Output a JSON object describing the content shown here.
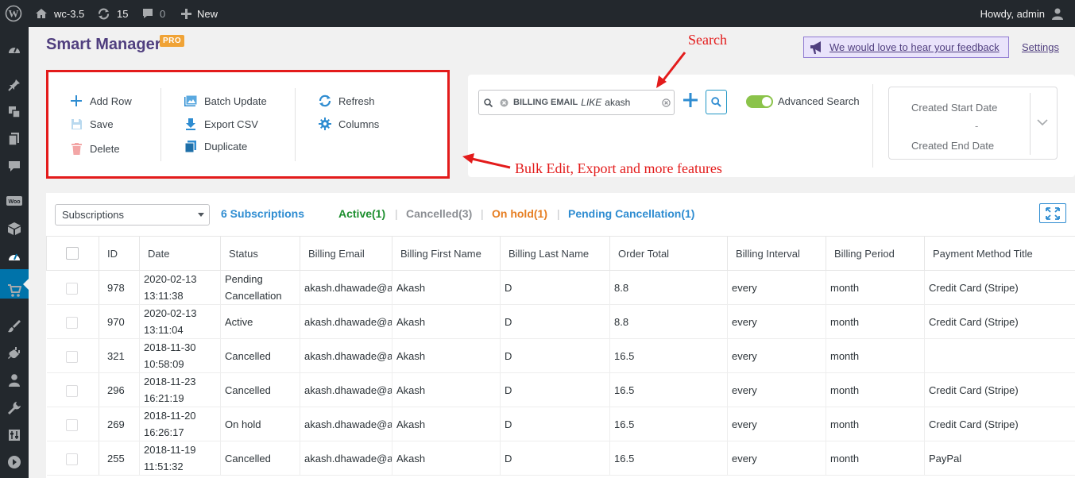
{
  "adminbar": {
    "site_name": "wc-3.5",
    "updates_count": "15",
    "comments_count": "0",
    "new_label": "New",
    "howdy": "Howdy, admin"
  },
  "header": {
    "title": "Smart Manager",
    "badge": "PRO",
    "feedback_link": "We would love to hear your feedback",
    "settings_link": "Settings"
  },
  "toolbar": {
    "add_row": "Add Row",
    "save": "Save",
    "delete": "Delete",
    "batch_update": "Batch Update",
    "export_csv": "Export CSV",
    "duplicate": "Duplicate",
    "refresh": "Refresh",
    "columns": "Columns"
  },
  "search": {
    "field": "BILLING EMAIL",
    "operator": "LIKE",
    "value": "akash",
    "advanced_label": "Advanced Search",
    "advanced_enabled": true
  },
  "date_filter": {
    "start_placeholder": "Created Start Date",
    "separator": "-",
    "end_placeholder": "Created End Date"
  },
  "annotations": {
    "search": "Search",
    "bulk": "Bulk Edit, Export and more features"
  },
  "grid": {
    "dashboard_select": "Subscriptions",
    "count_label": "6 Subscriptions",
    "filters": [
      {
        "label": "Active(1)",
        "color": "#1d8f2f"
      },
      {
        "label": "Cancelled(3)",
        "color": "#8c8f94"
      },
      {
        "label": "On hold(1)",
        "color": "#e67e22"
      },
      {
        "label": "Pending Cancellation(1)",
        "color": "#2e8cd1"
      }
    ],
    "columns": [
      "ID",
      "Date",
      "Status",
      "Billing Email",
      "Billing First Name",
      "Billing Last Name",
      "Order Total",
      "Billing Interval",
      "Billing Period",
      "Payment Method Title"
    ],
    "rows": [
      {
        "id": "978",
        "date": "2020-02-13",
        "time": "13:11:38",
        "status": "Pending Cancellation",
        "status_class": "st-pending",
        "email": "akash.dhawade@a",
        "first": "Akash",
        "last": "D",
        "total": "8.8",
        "interval": "every",
        "period": "month",
        "payment": "Credit Card (Stripe)"
      },
      {
        "id": "970",
        "date": "2020-02-13",
        "time": "13:11:04",
        "status": "Active",
        "status_class": "st-active",
        "email": "akash.dhawade@a",
        "first": "Akash",
        "last": "D",
        "total": "8.8",
        "interval": "every",
        "period": "month",
        "payment": "Credit Card (Stripe)"
      },
      {
        "id": "321",
        "date": "2018-11-30",
        "time": "10:58:09",
        "status": "Cancelled",
        "status_class": "st-cancelled",
        "email": "akash.dhawade@a",
        "first": "Akash",
        "last": "D",
        "total": "16.5",
        "interval": "every",
        "period": "month",
        "payment": ""
      },
      {
        "id": "296",
        "date": "2018-11-23",
        "time": "16:21:19",
        "status": "Cancelled",
        "status_class": "st-cancelled",
        "email": "akash.dhawade@a",
        "first": "Akash",
        "last": "D",
        "total": "16.5",
        "interval": "every",
        "period": "month",
        "payment": "Credit Card (Stripe)"
      },
      {
        "id": "269",
        "date": "2018-11-20",
        "time": "16:26:17",
        "status": "On hold",
        "status_class": "st-hold",
        "email": "akash.dhawade@a",
        "first": "Akash",
        "last": "D",
        "total": "16.5",
        "interval": "every",
        "period": "month",
        "payment": "Credit Card (Stripe)"
      },
      {
        "id": "255",
        "date": "2018-11-19",
        "time": "11:51:32",
        "status": "Cancelled",
        "status_class": "st-cancelled",
        "email": "akash.dhawade@a",
        "first": "Akash",
        "last": "D",
        "total": "16.5",
        "interval": "every",
        "period": "month",
        "payment": "PayPal"
      }
    ]
  }
}
